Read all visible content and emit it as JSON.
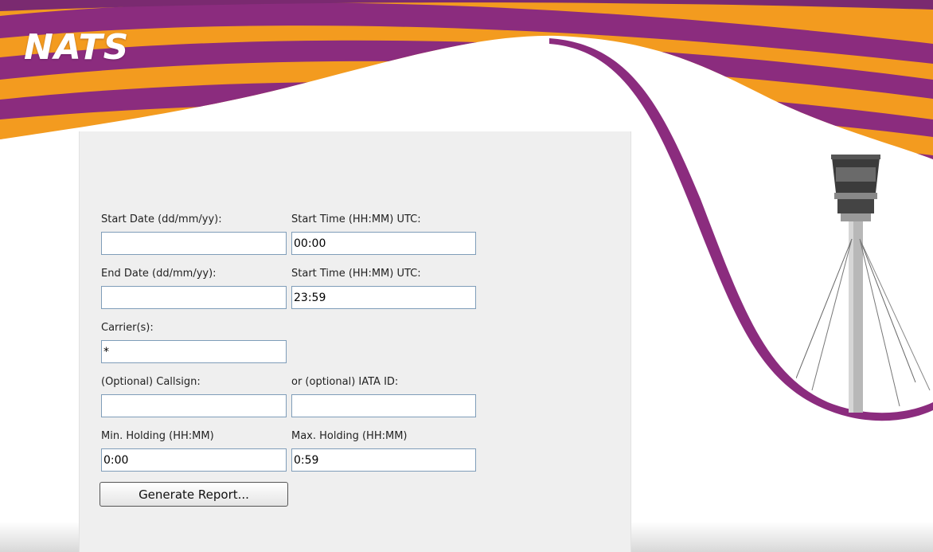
{
  "brand": {
    "logo_text": "NATS",
    "colors": {
      "purple": "#8b2c7e",
      "orange": "#f39b1f",
      "panel": "#efefef",
      "field_border": "#7f9db9"
    }
  },
  "form": {
    "start_date": {
      "label": "Start Date (dd/mm/yy):",
      "value": ""
    },
    "start_time": {
      "label": "Start Time (HH:MM) UTC:",
      "value": "00:00"
    },
    "end_date": {
      "label": "End Date (dd/mm/yy):",
      "value": ""
    },
    "end_time": {
      "label": "Start Time (HH:MM) UTC:",
      "value": "23:59"
    },
    "carriers": {
      "label": "Carrier(s):",
      "value": "*"
    },
    "callsign": {
      "label": "(Optional) Callsign:",
      "value": ""
    },
    "iata_id": {
      "label": "or (optional) IATA ID:",
      "value": ""
    },
    "min_holding": {
      "label": "Min. Holding (HH:MM)",
      "value": "0:00"
    },
    "max_holding": {
      "label": "Max. Holding (HH:MM)",
      "value": "0:59"
    },
    "submit_label": "Generate Report..."
  },
  "decor": {
    "tower_icon": "control-tower-icon"
  }
}
